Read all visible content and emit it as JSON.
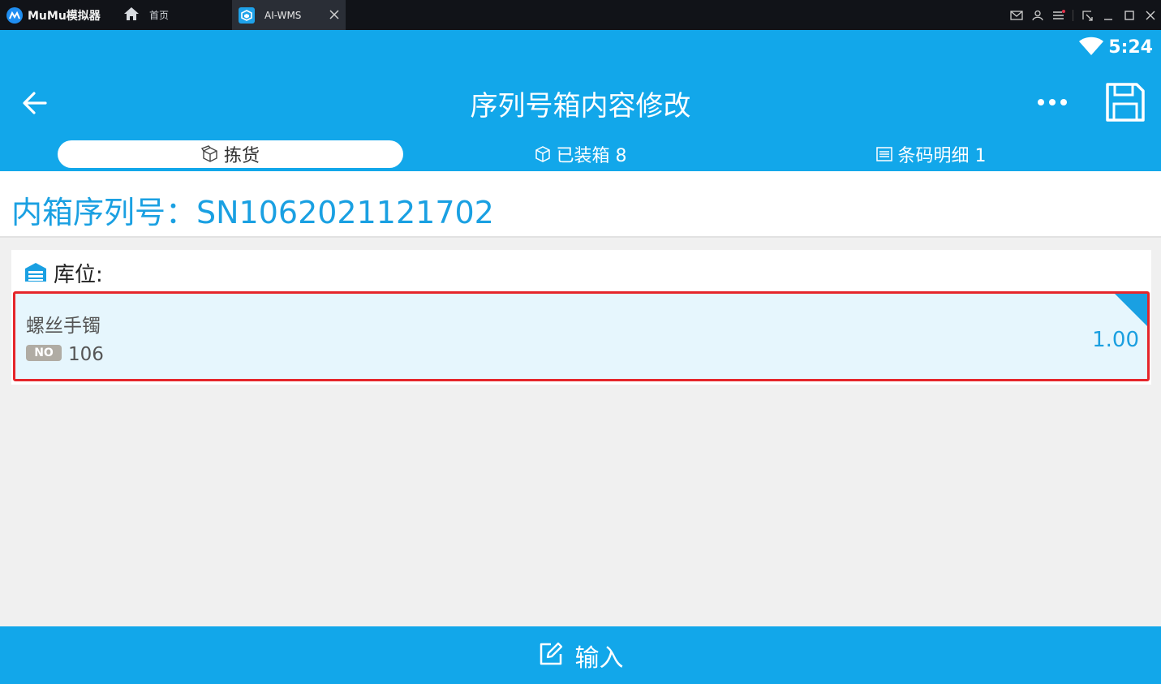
{
  "window": {
    "brand": "MuMu模拟器",
    "tabs": [
      {
        "label": "首页",
        "icon": "home-icon"
      },
      {
        "label": "AI-WMS",
        "icon": "app-icon"
      }
    ],
    "controls": [
      "mail-icon",
      "user-icon",
      "menu-icon",
      "resize-icon",
      "minimize-icon",
      "maximize-icon",
      "close-icon"
    ]
  },
  "status": {
    "time": "5:24"
  },
  "header": {
    "title": "序列号箱内容修改"
  },
  "tabs": [
    {
      "label": "拣货",
      "active": true,
      "icon": "box-open-icon"
    },
    {
      "label": "已装箱 8",
      "active": false,
      "icon": "cube-icon"
    },
    {
      "label": "条码明细 1",
      "active": false,
      "icon": "list-icon"
    }
  ],
  "serial": {
    "text": "内箱序列号：SN1062021121702"
  },
  "location": {
    "label": "库位:",
    "items": [
      {
        "name": "螺丝手镯",
        "badge": "NO",
        "number": "106",
        "qty": "1.00"
      }
    ]
  },
  "bottom": {
    "label": "输入"
  },
  "colors": {
    "primary": "#12a7ea",
    "highlight": "#e5262b",
    "row_bg": "#e6f6fd"
  }
}
